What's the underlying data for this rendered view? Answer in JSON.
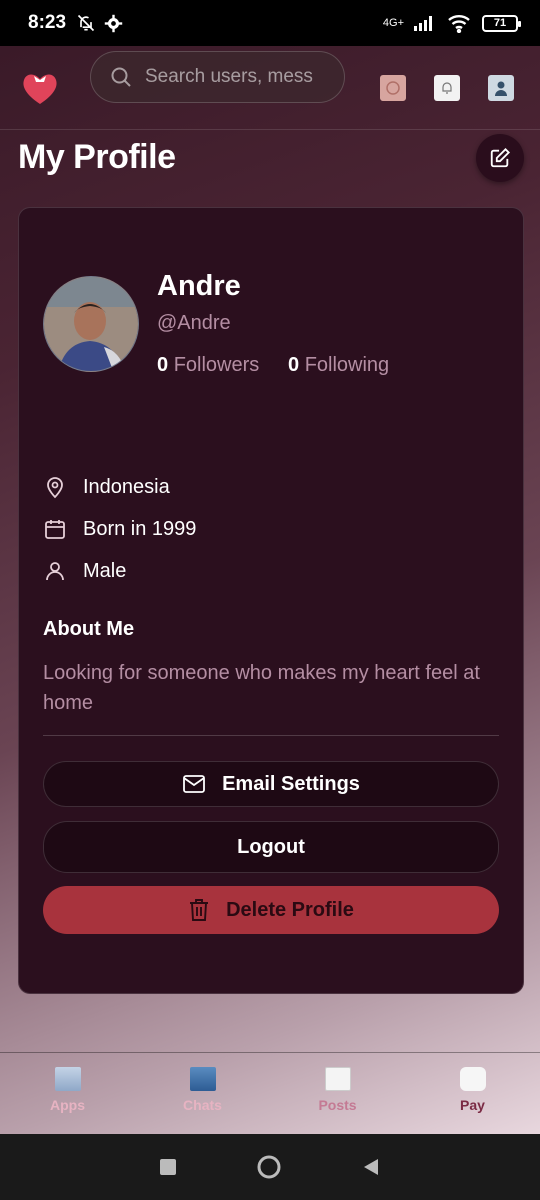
{
  "status_bar": {
    "time": "8:23",
    "network": "4G+",
    "battery": "71"
  },
  "header": {
    "search_placeholder": "Search users, mess",
    "icons": [
      "app-logo-icon",
      "search-icon",
      "avatar-thumb-icon",
      "notification-bell-icon",
      "profile-thumb-icon"
    ]
  },
  "page": {
    "title": "My Profile"
  },
  "profile": {
    "name": "Andre",
    "handle": "@Andre",
    "followers_count": "0",
    "followers_label": "Followers",
    "following_count": "0",
    "following_label": "Following",
    "location": "Indonesia",
    "born": "Born in 1999",
    "gender": "Male",
    "about_title": "About Me",
    "about_text": "Looking for someone who makes my heart feel at home"
  },
  "actions": {
    "email_settings": "Email Settings",
    "logout": "Logout",
    "delete_profile": "Delete Profile"
  },
  "bottom_nav": {
    "items": [
      {
        "label": "Apps",
        "color": "#e7b3c2"
      },
      {
        "label": "Chats",
        "color": "#e7b3c2"
      },
      {
        "label": "Posts",
        "color": "#c47a94"
      },
      {
        "label": "Pay",
        "color": "#7a2a44"
      }
    ]
  },
  "colors": {
    "accent": "#a8333d",
    "card": "#2b0f1e",
    "muted_text": "#b48ea3"
  }
}
